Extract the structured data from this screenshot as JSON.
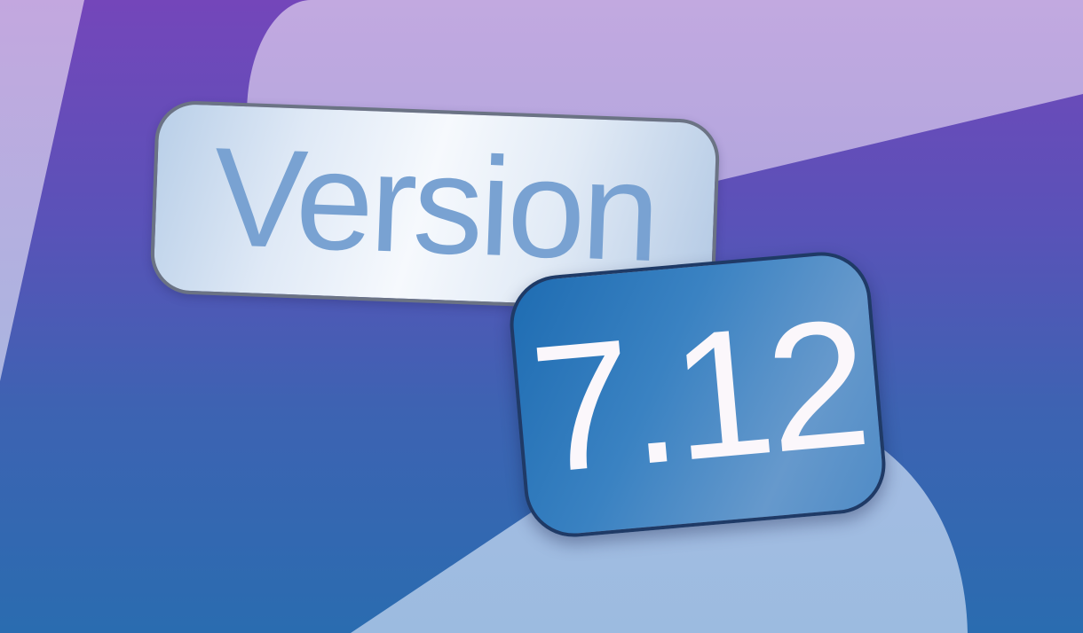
{
  "badge_label": "Version",
  "version_number": "7.12",
  "colors": {
    "background_purple": "#7446ba",
    "background_blue": "#2a6cb0",
    "light_lavender": "#c1a8e0",
    "light_blue": "#a0bbe0",
    "version_text": "#79a2d2",
    "number_badge_blue": "#2f78bc",
    "number_text": "#fbf7fb"
  }
}
